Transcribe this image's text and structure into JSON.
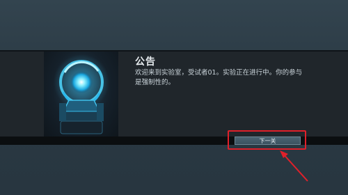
{
  "announcement": {
    "title": "公告",
    "message": "欢迎来到实验室，受试者01。实验正在进行中。你的参与是强制性的。"
  },
  "buttons": {
    "next_label": "下一关"
  },
  "colors": {
    "highlight": "#e0202a",
    "accent_glow": "#3fd0ff"
  },
  "icons": {
    "artwork": "glowing-orb-device-icon",
    "annotation": "red-arrow-icon"
  }
}
